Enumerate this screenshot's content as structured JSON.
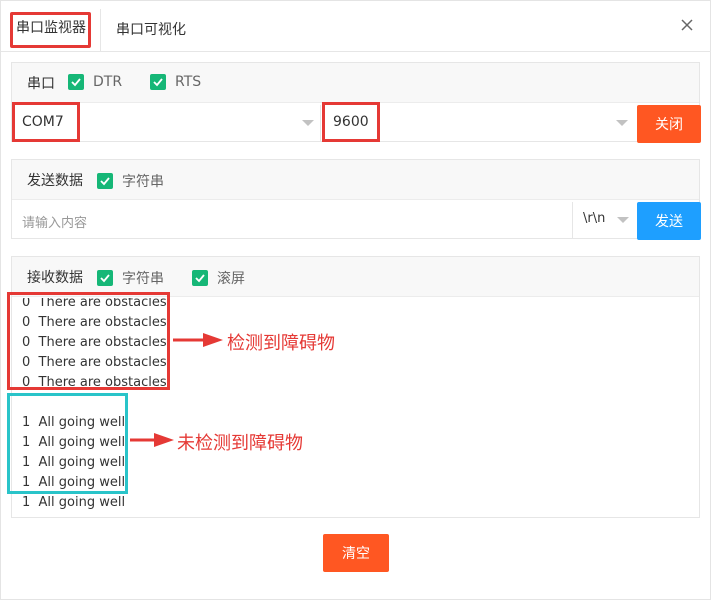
{
  "tabs": [
    {
      "label": "串口监视器"
    },
    {
      "label": "串口可视化"
    }
  ],
  "serial": {
    "title": "串口",
    "dtr_label": "DTR",
    "rts_label": "RTS",
    "port_value": "COM7",
    "baud_value": "9600",
    "close_button": "关闭"
  },
  "send": {
    "title": "发送数据",
    "string_label": "字符串",
    "input_placeholder": "请输入内容",
    "newline_value": "\\r\\n",
    "send_button": "发送"
  },
  "receive": {
    "title": "接收数据",
    "string_label": "字符串",
    "scroll_label": "滚屏",
    "lines": [
      "0  There are obstacles",
      "0  There are obstacles",
      "0  There are obstacles",
      "0  There are obstacles",
      "0  There are obstacles",
      "1  All going well",
      "1  All going well",
      "1  All going well",
      "1  All going well",
      "1  All going well"
    ]
  },
  "annotations": {
    "obstacle": "检测到障碍物",
    "no_obstacle": "未检测到障碍物"
  },
  "clear_button": "清空",
  "colors": {
    "checkbox": "#16b777",
    "orange_button": "#ff5722",
    "blue_button": "#1e9fff",
    "highlight_red": "#e53935",
    "highlight_cyan": "#29c4c9"
  }
}
